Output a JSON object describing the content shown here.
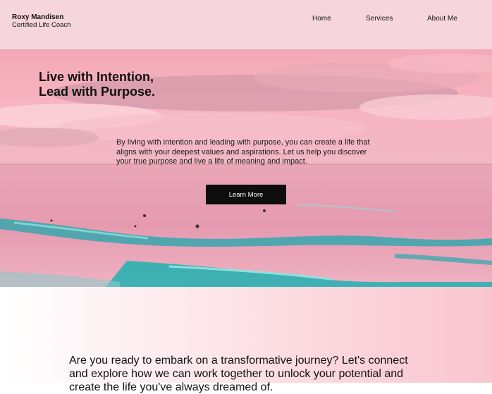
{
  "header": {
    "brand_name": "Roxy Mandisen",
    "brand_subtitle": "Certified Life Coach",
    "nav": [
      {
        "label": "Home"
      },
      {
        "label": "Services"
      },
      {
        "label": "About Me"
      }
    ]
  },
  "hero": {
    "title_line1": "Live with Intention,",
    "title_line2": "Lead with Purpose.",
    "text": "By living with intention and leading with purpose, you can create a life that aligns with your deepest values and aspirations. Let us help you discover your true purpose and live a life of meaning and impact.",
    "cta_label": "Learn More"
  },
  "lower": {
    "text": "Are you ready to embark on a transformative journey? Let's connect and explore how we can work together to unlock your potential and create the life you've always dreamed of."
  },
  "colors": {
    "header_bg": "#f6d6dc",
    "cta_bg": "#0d0d0d",
    "sky": "#f4a3b6",
    "sea": "#e8a2b4",
    "wave": "#2ab0b4"
  }
}
